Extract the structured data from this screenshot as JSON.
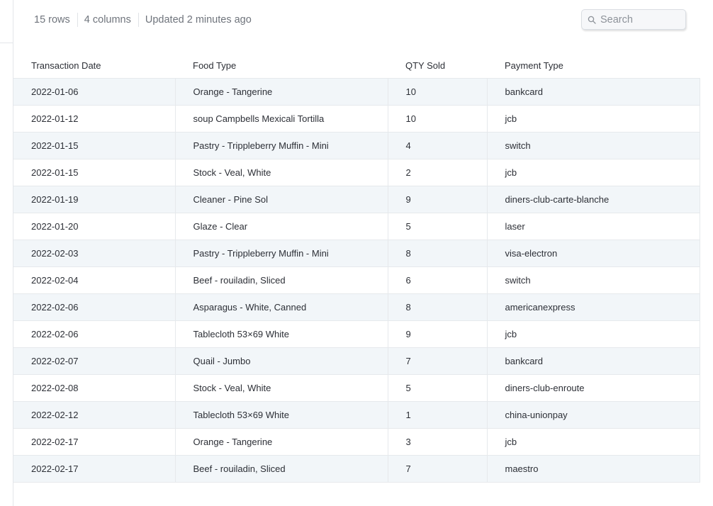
{
  "meta": {
    "rows_label": "15 rows",
    "columns_label": "4 columns",
    "updated_label": "Updated 2 minutes ago"
  },
  "search": {
    "placeholder": "Search",
    "value": ""
  },
  "table": {
    "columns": [
      "Transaction Date",
      "Food Type",
      "QTY Sold",
      "Payment Type"
    ],
    "rows": [
      [
        "2022-01-06",
        "Orange - Tangerine",
        "10",
        "bankcard"
      ],
      [
        "2022-01-12",
        "soup Campbells Mexicali Tortilla",
        "10",
        "jcb"
      ],
      [
        "2022-01-15",
        "Pastry - Trippleberry Muffin - Mini",
        "4",
        "switch"
      ],
      [
        "2022-01-15",
        "Stock - Veal, White",
        "2",
        "jcb"
      ],
      [
        "2022-01-19",
        "Cleaner - Pine Sol",
        "9",
        "diners-club-carte-blanche"
      ],
      [
        "2022-01-20",
        "Glaze - Clear",
        "5",
        "laser"
      ],
      [
        "2022-02-03",
        "Pastry - Trippleberry Muffin - Mini",
        "8",
        "visa-electron"
      ],
      [
        "2022-02-04",
        "Beef - rouiladin, Sliced",
        "6",
        "switch"
      ],
      [
        "2022-02-06",
        "Asparagus - White, Canned",
        "8",
        "americanexpress"
      ],
      [
        "2022-02-06",
        "Tablecloth 53×69 White",
        "9",
        "jcb"
      ],
      [
        "2022-02-07",
        "Quail - Jumbo",
        "7",
        "bankcard"
      ],
      [
        "2022-02-08",
        "Stock - Veal, White",
        "5",
        "diners-club-enroute"
      ],
      [
        "2022-02-12",
        "Tablecloth 53×69 White",
        "1",
        "china-unionpay"
      ],
      [
        "2022-02-17",
        "Orange - Tangerine",
        "3",
        "jcb"
      ],
      [
        "2022-02-17",
        "Beef - rouiladin, Sliced",
        "7",
        "maestro"
      ]
    ]
  },
  "icons": {
    "search": "search-icon"
  },
  "colors": {
    "row_stripe": "#f2f6f9",
    "border": "#e6e9ec",
    "muted_text": "#6f747c"
  }
}
